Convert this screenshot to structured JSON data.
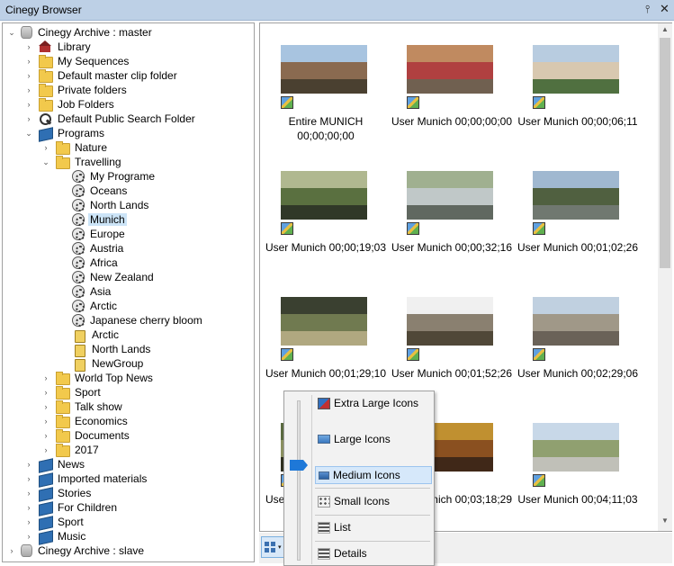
{
  "window": {
    "title": "Cinegy Browser",
    "pin_glyph": "⫯",
    "close_glyph": "✕"
  },
  "tree": [
    {
      "label": "Cinegy Archive : master",
      "icon": "db-icon",
      "level": 0,
      "chev": "⌄",
      "selected": false
    },
    {
      "label": "Library",
      "icon": "house-icon",
      "level": 1,
      "chev": "›",
      "selected": false
    },
    {
      "label": "My Sequences",
      "icon": "folder-icon",
      "level": 1,
      "chev": "›",
      "selected": false
    },
    {
      "label": "Default master clip folder",
      "icon": "folder-icon",
      "level": 1,
      "chev": "›",
      "selected": false
    },
    {
      "label": "Private folders",
      "icon": "folder-icon",
      "level": 1,
      "chev": "›",
      "selected": false
    },
    {
      "label": "Job Folders",
      "icon": "folder-icon",
      "level": 1,
      "chev": "›",
      "selected": false
    },
    {
      "label": "Default Public Search Folder",
      "icon": "search-icon",
      "level": 1,
      "chev": "›",
      "selected": false
    },
    {
      "label": "Programs",
      "icon": "book-icon",
      "level": 1,
      "chev": "⌄",
      "selected": false
    },
    {
      "label": "Nature",
      "icon": "folder-icon",
      "level": 2,
      "chev": "›",
      "selected": false
    },
    {
      "label": "Travelling",
      "icon": "folder-icon",
      "level": 2,
      "chev": "⌄",
      "selected": false
    },
    {
      "label": "My Programe",
      "icon": "reel-icon",
      "level": 3,
      "chev": "",
      "selected": false
    },
    {
      "label": "Oceans",
      "icon": "reel-icon",
      "level": 3,
      "chev": "",
      "selected": false
    },
    {
      "label": "North Lands",
      "icon": "reel-icon",
      "level": 3,
      "chev": "",
      "selected": false
    },
    {
      "label": "Munich",
      "icon": "reel-icon",
      "level": 3,
      "chev": "",
      "selected": true
    },
    {
      "label": "Europe",
      "icon": "reel-icon",
      "level": 3,
      "chev": "",
      "selected": false
    },
    {
      "label": "Austria",
      "icon": "reel-icon",
      "level": 3,
      "chev": "",
      "selected": false
    },
    {
      "label": "Africa",
      "icon": "reel-icon",
      "level": 3,
      "chev": "",
      "selected": false
    },
    {
      "label": "New Zealand",
      "icon": "reel-icon",
      "level": 3,
      "chev": "",
      "selected": false
    },
    {
      "label": "Asia",
      "icon": "reel-icon",
      "level": 3,
      "chev": "",
      "selected": false
    },
    {
      "label": "Arctic",
      "icon": "reel-icon",
      "level": 3,
      "chev": "",
      "selected": false
    },
    {
      "label": "Japanese cherry bloom",
      "icon": "reel-icon",
      "level": 3,
      "chev": "",
      "selected": false
    },
    {
      "label": "Arctic",
      "icon": "bin-icon",
      "level": 3,
      "chev": "",
      "selected": false
    },
    {
      "label": "North Lands",
      "icon": "bin-icon",
      "level": 3,
      "chev": "",
      "selected": false
    },
    {
      "label": "NewGroup",
      "icon": "bin-icon",
      "level": 3,
      "chev": "",
      "selected": false
    },
    {
      "label": "World Top News",
      "icon": "folder-icon",
      "level": 2,
      "chev": "›",
      "selected": false
    },
    {
      "label": "Sport",
      "icon": "folder-icon",
      "level": 2,
      "chev": "›",
      "selected": false
    },
    {
      "label": "Talk show",
      "icon": "folder-icon",
      "level": 2,
      "chev": "›",
      "selected": false
    },
    {
      "label": "Economics",
      "icon": "folder-icon",
      "level": 2,
      "chev": "›",
      "selected": false
    },
    {
      "label": "Documents",
      "icon": "folder-icon",
      "level": 2,
      "chev": "›",
      "selected": false
    },
    {
      "label": "2017",
      "icon": "folder-icon",
      "level": 2,
      "chev": "›",
      "selected": false
    },
    {
      "label": "News",
      "icon": "book-icon",
      "level": 1,
      "chev": "›",
      "selected": false
    },
    {
      "label": "Imported materials",
      "icon": "book-icon",
      "level": 1,
      "chev": "›",
      "selected": false
    },
    {
      "label": "Stories",
      "icon": "book-icon",
      "level": 1,
      "chev": "›",
      "selected": false
    },
    {
      "label": "For Children",
      "icon": "book-icon",
      "level": 1,
      "chev": "›",
      "selected": false
    },
    {
      "label": "Sport",
      "icon": "book-icon",
      "level": 1,
      "chev": "›",
      "selected": false
    },
    {
      "label": "Music",
      "icon": "book-icon",
      "level": 1,
      "chev": "›",
      "selected": false
    },
    {
      "label": "Cinegy Archive : slave",
      "icon": "db-icon",
      "level": 0,
      "chev": "›",
      "selected": false
    }
  ],
  "clips": [
    {
      "label": "Entire MUNICH 00;00;00;00",
      "colors": [
        "#a8c4e0",
        "#8a6a50",
        "#4a4030"
      ]
    },
    {
      "label": "User Munich 00;00;00;00",
      "colors": [
        "#c08a60",
        "#b04040",
        "#706050"
      ]
    },
    {
      "label": "User Munich 00;00;06;11",
      "colors": [
        "#b8cce0",
        "#d8c8b0",
        "#507040"
      ]
    },
    {
      "label": "User Munich 00;00;19;03",
      "colors": [
        "#b0b890",
        "#5a7040",
        "#303828"
      ]
    },
    {
      "label": "User Munich 00;00;32;16",
      "colors": [
        "#a0b090",
        "#c0c8c8",
        "#606860"
      ]
    },
    {
      "label": "User Munich 00;01;02;26",
      "colors": [
        "#a0b8d0",
        "#506040",
        "#707870"
      ]
    },
    {
      "label": "User Munich 00;01;29;10",
      "colors": [
        "#3a4030",
        "#707a50",
        "#b0a880"
      ]
    },
    {
      "label": "User Munich 00;01;52;26",
      "colors": [
        "#f0f0f0",
        "#8a8070",
        "#504838"
      ]
    },
    {
      "label": "User Munich 00;02;29;06",
      "colors": [
        "#c0d0e0",
        "#a09888",
        "#6a6258"
      ]
    },
    {
      "label": "User Munich 00;03;05;00",
      "colors": [
        "#5a6a40",
        "#8a9060",
        "#303020"
      ]
    },
    {
      "label": "User Munich 00;03;18;29",
      "colors": [
        "#c09030",
        "#8a5020",
        "#402818"
      ]
    },
    {
      "label": "User Munich 00;04;11;03",
      "colors": [
        "#c8d8e8",
        "#90a070",
        "#c0c0b8"
      ]
    }
  ],
  "view_menu": {
    "items": [
      {
        "label": "Extra Large Icons",
        "icon": "extra-large-icons-icon",
        "active": false
      },
      {
        "label": "Large Icons",
        "icon": "large-icons-icon",
        "active": false
      },
      {
        "label": "Medium Icons",
        "icon": "medium-icons-icon",
        "active": true
      },
      {
        "label": "Small Icons",
        "icon": "small-icons-icon",
        "active": false
      },
      {
        "label": "List",
        "icon": "list-icon",
        "active": false
      },
      {
        "label": "Details",
        "icon": "details-icon",
        "active": false
      }
    ]
  },
  "view_toggle": {
    "icon": "view-mode-icon",
    "dropdown_glyph": "▾"
  },
  "scroll": {
    "up_glyph": "▲",
    "down_glyph": "▼"
  }
}
